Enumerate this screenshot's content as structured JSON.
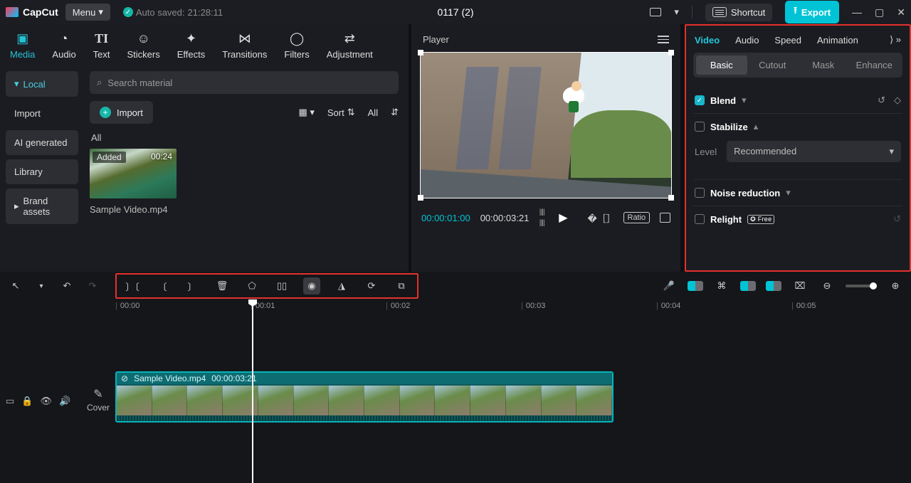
{
  "titlebar": {
    "brand": "CapCut",
    "menu": "Menu",
    "autosave_prefix": "Auto saved:",
    "autosave_time": "21:28:11",
    "project_title": "0117 (2)",
    "shortcut": "Shortcut",
    "export": "Export"
  },
  "media_tabs": [
    {
      "label": "Media",
      "active": true
    },
    {
      "label": "Audio"
    },
    {
      "label": "Text"
    },
    {
      "label": "Stickers"
    },
    {
      "label": "Effects"
    },
    {
      "label": "Transitions"
    },
    {
      "label": "Filters"
    },
    {
      "label": "Adjustment"
    }
  ],
  "sidebar": {
    "local": "Local",
    "import": "Import",
    "ai": "AI generated",
    "library": "Library",
    "brand": "Brand assets"
  },
  "media_panel": {
    "search_placeholder": "Search material",
    "import_btn": "Import",
    "sort_label": "Sort",
    "all_pill": "All",
    "all_heading": "All",
    "clip_added": "Added",
    "clip_dur": "00:24",
    "clip_name": "Sample Video.mp4"
  },
  "player": {
    "title": "Player",
    "current": "00:00:01:00",
    "duration": "00:00:03:21",
    "ratio": "Ratio"
  },
  "inspector": {
    "tabs": {
      "video": "Video",
      "audio": "Audio",
      "speed": "Speed",
      "animation": "Animation"
    },
    "subtabs": {
      "basic": "Basic",
      "cutout": "Cutout",
      "mask": "Mask",
      "enhance": "Enhance"
    },
    "blend": "Blend",
    "stabilize": "Stabilize",
    "level_label": "Level",
    "level_value": "Recommended",
    "noise": "Noise reduction",
    "relight": "Relight",
    "free": "✪ Free"
  },
  "timeline": {
    "ticks": [
      "00:00",
      "00:01",
      "00:02",
      "00:03",
      "00:04",
      "00:05"
    ],
    "clip_name": "Sample Video.mp4",
    "clip_dur": "00:00:03:21",
    "cover": "Cover"
  }
}
